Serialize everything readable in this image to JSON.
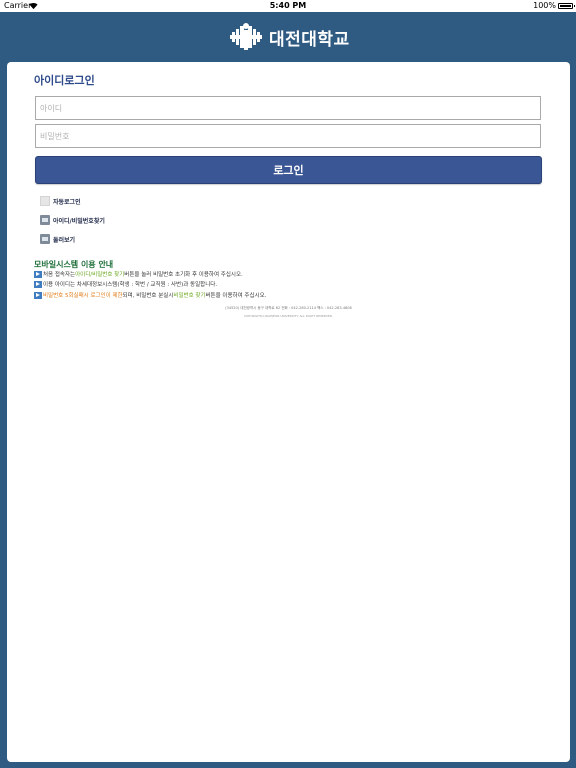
{
  "status_bar": {
    "carrier": "Carrier",
    "time": "5:40 PM",
    "battery": "100%"
  },
  "header": {
    "logo_text": "대전대학교",
    "background_color": "#2f5b82"
  },
  "login": {
    "title": "아이디로그인",
    "id_placeholder": "아이디",
    "pw_placeholder": "비밀번호",
    "button_label": "로그인",
    "auto_login_label": "자동로그인",
    "find_id_pw_label": "아이디/비밀번호찾기",
    "look_around_label": "둘러보기"
  },
  "guide": {
    "title": "모바일시스템 이용 안내",
    "line1": {
      "prefix": "처음 접속자는 ",
      "highlight": "아이디/비밀번호 찾기",
      "suffix": " 버튼을 눌러 비밀번호 초기화 후 이용하여 주십시오."
    },
    "line2": {
      "text": "이용 아이디는 차세대정보시스템(학생 : 학번 / 교직원 : 사번)과 동일합니다."
    },
    "line3": {
      "highlight1": "비밀번호 5회실패시 로그인이 제한",
      "middle": "되며, 비밀번호 분실시 ",
      "highlight2": "비밀번호 찾기",
      "suffix": " 버튼을 이용하여 주십시오."
    }
  },
  "footer": {
    "address": "(34520) 대전광역시 동구 대학로 62   전화 : 042-280-2114   팩스 : 042-283-4808",
    "copyright": "COPYRIGHT(C)DAEJEON UNIVERSITY. ALL RIGHT RESERVED."
  }
}
